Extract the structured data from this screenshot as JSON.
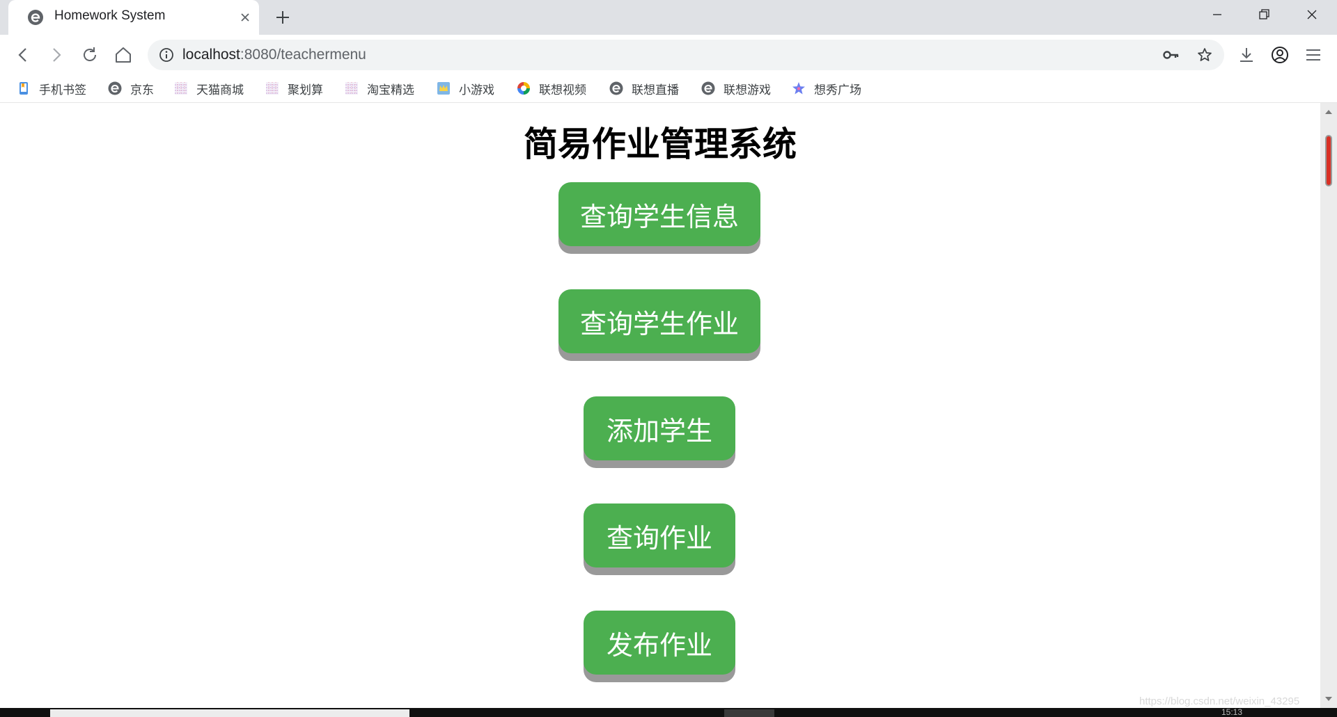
{
  "browser": {
    "tab": {
      "title": "Homework System",
      "icon": "browser-logo-icon"
    },
    "toolbar": {
      "url_host": "localhost",
      "url_rest": ":8080/teachermenu"
    },
    "bookmarks": [
      {
        "label": "手机书签",
        "icon": "phone-bookmark-icon"
      },
      {
        "label": "京东",
        "icon": "browser-logo-icon"
      },
      {
        "label": "天猫商城",
        "icon": "placeholder-image-icon"
      },
      {
        "label": "聚划算",
        "icon": "placeholder-image-icon"
      },
      {
        "label": "淘宝精选",
        "icon": "placeholder-image-icon"
      },
      {
        "label": "小游戏",
        "icon": "game-crown-icon"
      },
      {
        "label": "联想视频",
        "icon": "video-ring-icon"
      },
      {
        "label": "联想直播",
        "icon": "browser-logo-icon"
      },
      {
        "label": "联想游戏",
        "icon": "browser-logo-icon"
      },
      {
        "label": "想秀广场",
        "icon": "star-sparkle-icon"
      }
    ]
  },
  "page": {
    "title": "简易作业管理系统",
    "buttons": [
      {
        "label": "查询学生信息"
      },
      {
        "label": "查询学生作业"
      },
      {
        "label": "添加学生"
      },
      {
        "label": "查询作业"
      },
      {
        "label": "发布作业"
      }
    ],
    "button_color": "#4caf50",
    "button_shadow_color": "#999999"
  },
  "footer": {
    "watermark": "https://blog.csdn.net/weixin_43295",
    "clock": "15:13"
  }
}
